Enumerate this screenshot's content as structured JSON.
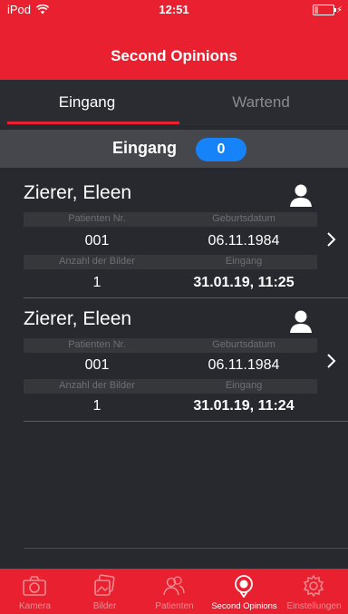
{
  "status_bar": {
    "carrier": "iPod",
    "time": "12:51",
    "battery_level": 0.2
  },
  "header": {
    "title": "Second Opinions"
  },
  "tabs": [
    {
      "label": "Eingang",
      "selected": true
    },
    {
      "label": "Wartend",
      "selected": false
    }
  ],
  "section": {
    "title": "Eingang",
    "count": "0"
  },
  "patients": [
    {
      "name": "Zierer, Eleen",
      "patient_nr_label": "Patienten Nr.",
      "birthdate_label": "Geburtsdatum",
      "patient_nr": "001",
      "birthdate": "06.11.1984",
      "image_count_label": "Anzahl der Bilder",
      "received_label": "Eingang",
      "image_count": "1",
      "received": "31.01.19, 11:25"
    },
    {
      "name": "Zierer, Eleen",
      "patient_nr_label": "Patienten Nr.",
      "birthdate_label": "Geburtsdatum",
      "patient_nr": "001",
      "birthdate": "06.11.1984",
      "image_count_label": "Anzahl der Bilder",
      "received_label": "Eingang",
      "image_count": "1",
      "received": "31.01.19, 11:24"
    }
  ],
  "tab_bar": [
    {
      "label": "Kamera",
      "icon": "camera-icon"
    },
    {
      "label": "Bilder",
      "icon": "images-icon"
    },
    {
      "label": "Patienten",
      "icon": "patients-icon"
    },
    {
      "label": "Second Opinions",
      "icon": "second-opinion-icon",
      "selected": true
    },
    {
      "label": "Einstellungen",
      "icon": "settings-icon"
    }
  ],
  "colors": {
    "brand_red": "#e8202f",
    "badge_blue": "#1683f8",
    "background": "#28292e"
  }
}
